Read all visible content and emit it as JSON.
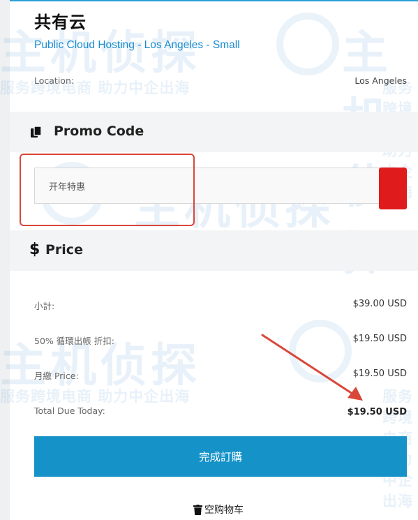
{
  "store": {
    "title": "共有云",
    "product_link": "Public Cloud Hosting - Los Angeles - Small"
  },
  "location": {
    "label": "Location:",
    "value": "Los Angeles"
  },
  "promo": {
    "heading": "Promo Code",
    "input_value": "开年特惠",
    "apply_button_color": "#e01b1b"
  },
  "price": {
    "heading": "Price",
    "rows": [
      {
        "label": "小計:",
        "value": "$39.00 USD"
      },
      {
        "label": "50% 循環出帳 折扣:",
        "value": "$19.50 USD"
      },
      {
        "label": "月繳 Price:",
        "value": "$19.50 USD"
      },
      {
        "label": "Total Due Today:",
        "value": "$19.50 USD"
      }
    ]
  },
  "checkout": {
    "button_label": "完成訂購",
    "empty_cart_label": "空购物车"
  },
  "watermark": {
    "brand": "主机侦探",
    "slogan": "服务跨境电商 助力中企出海"
  },
  "colors": {
    "accent": "#1592c8",
    "link": "#1a8ccf",
    "annotation": "#d9473a"
  }
}
